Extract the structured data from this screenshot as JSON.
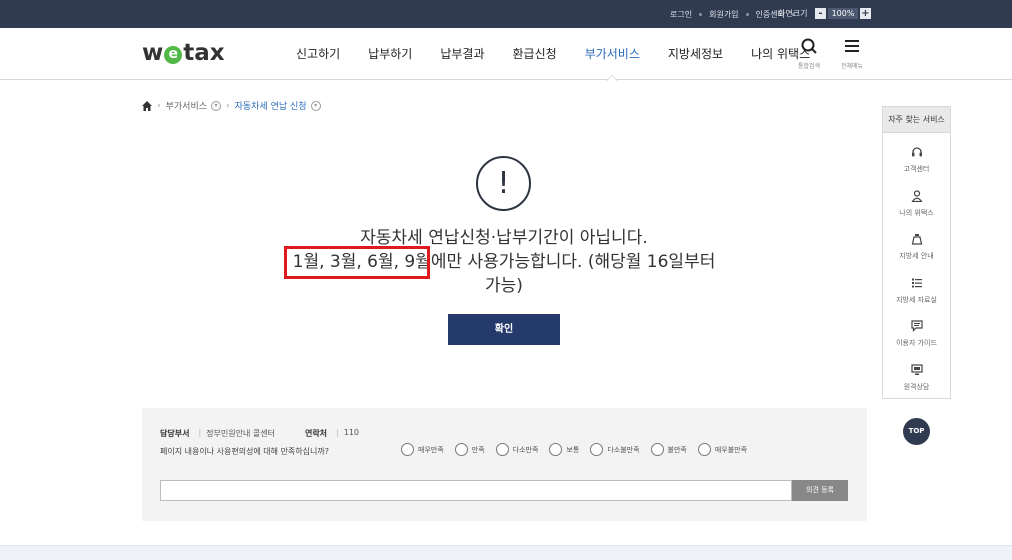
{
  "topbar": {
    "login": "로그인",
    "signup": "회원가입",
    "cert": "인증센터",
    "zoom_label": "화면크기",
    "zoom_minus": "-",
    "zoom_value": "100%",
    "zoom_plus": "+"
  },
  "header": {
    "logo_w": "w",
    "logo_e": "e",
    "logo_rest": "tax",
    "nav": [
      "신고하기",
      "납부하기",
      "납부결과",
      "환급신청",
      "부가서비스",
      "지방세정보",
      "나의 위택스"
    ],
    "search_caption": "통합검색",
    "menu_caption": "전체메뉴",
    "accent_color": "#2a6ab9"
  },
  "breadcrumb": {
    "level1": "부가서비스",
    "level2": "자동차세 연납 신청"
  },
  "message": {
    "icon": "!",
    "line1": "자동차세 연납신청·납부기간이 아닙니다.",
    "line2": "1월, 3월, 6월, 9월에만 사용가능합니다. (해당월 16일부터",
    "line3": "가능)",
    "confirm": "확인"
  },
  "quick": {
    "title": "자주 찾는 서비스",
    "items": [
      "고객센터",
      "나의 위택스",
      "지방세 안내",
      "지방세 자료실",
      "이용자 가이드",
      "원격상담"
    ],
    "top": "TOP"
  },
  "survey": {
    "dept_label": "담당부서",
    "dept_value": "정부민원안내 콜센터",
    "contact_label": "연락처",
    "contact_value": "110",
    "question": "페이지 내용이나 사용편의성에 대해 만족하십니까?",
    "options": [
      "매우만족",
      "만족",
      "다소만족",
      "보통",
      "다소불만족",
      "불만족",
      "매우불만족"
    ],
    "submit": "의견 등록"
  }
}
